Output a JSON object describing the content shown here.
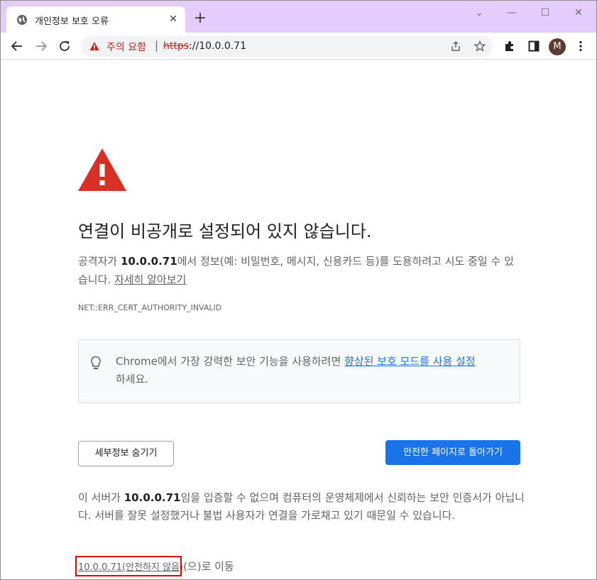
{
  "tab": {
    "title": "개인정보 보호 오류",
    "close_glyph": "✕",
    "new_tab_glyph": "+"
  },
  "window_controls": {
    "minimize": "—",
    "maximize": "☐",
    "close": "✕",
    "tab_search": "⌄"
  },
  "omnibox": {
    "security_label": "주의 요함",
    "separator": "|",
    "url_scheme": "https",
    "url_rest": "://10.0.0.71"
  },
  "profile": {
    "initial": "M"
  },
  "page": {
    "heading": "연결이 비공개로 설정되어 있지 않습니다.",
    "para1_prefix": "공격자가 ",
    "para1_host": "10.0.0.71",
    "para1_suffix": "에서 정보(예: 비밀번호, 메시지, 신용카드 등)를 도용하려고 시도 중일 수 있습니다. ",
    "learn_more": "자세히 알아보기",
    "error_code": "NET::ERR_CERT_AUTHORITY_INVALID",
    "hint_prefix": "Chrome에서 가장 강력한 보안 기능을 사용하려면 ",
    "hint_link": "향상된 보호 모드를 사용 설정",
    "hint_suffix": "하세요.",
    "hide_details_button": "세부정보 숨기기",
    "back_to_safety_button": "안전한 페이지로 돌아가기",
    "para2_prefix": "이 서버가 ",
    "para2_host": "10.0.0.71",
    "para2_suffix": "임을 입증할 수 없으며 컴퓨터의 운영체제에서 신뢰하는 보안 인증서가 아닙니다. 서버를 잘못 설정했거나 불법 사용자가 연결을 가로채고 있기 때문일 수 있습니다.",
    "proceed_link": "10.0.0.71(안전하지 않음)",
    "proceed_suffix": "(으)로 이동"
  },
  "colors": {
    "accent_blue": "#1a73e8",
    "warning_red": "#d93025",
    "tabstrip": "#e4cdfd",
    "highlight_box": "#e60000"
  },
  "icons": [
    "globe-icon",
    "back-arrow-icon",
    "forward-arrow-icon",
    "reload-icon",
    "warning-triangle-icon",
    "share-icon",
    "star-icon",
    "extensions-icon",
    "side-panel-icon",
    "more-menu-icon",
    "lightbulb-icon"
  ]
}
